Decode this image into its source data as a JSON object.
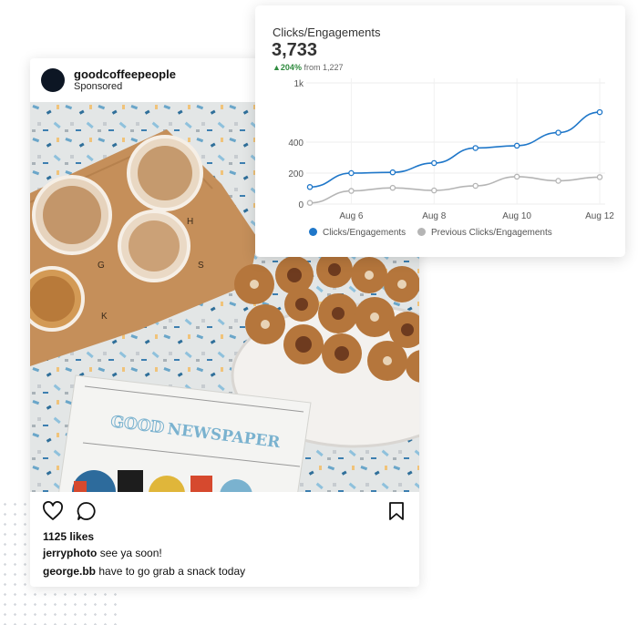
{
  "post": {
    "username": "goodcoffeepeople",
    "sponsored": "Sponsored",
    "likes": "1125 likes",
    "comments": [
      {
        "user": "jerryphoto",
        "text": "see ya soon!"
      },
      {
        "user": "george.bb",
        "text": "have to go grab a snack today"
      }
    ],
    "photo_text": {
      "newspaper_title_a": "GOOD",
      "newspaper_title_b": "NEWSPAPER",
      "board_letters": [
        "H",
        "S",
        "G",
        "K"
      ]
    },
    "icons": [
      "heart-icon",
      "comment-icon",
      "bookmark-icon"
    ]
  },
  "stats": {
    "title": "Clicks/Engagements",
    "value": "3,733",
    "change_pct": "204%",
    "change_from": "from 1,227"
  },
  "chart_data": {
    "type": "line",
    "x": [
      "Aug 5",
      "Aug 6",
      "Aug 7",
      "Aug 8",
      "Aug 9",
      "Aug 10",
      "Aug 11",
      "Aug 12"
    ],
    "xticks": [
      "Aug 6",
      "Aug 8",
      "Aug 10",
      "Aug 12"
    ],
    "yticks": [
      "0",
      "200",
      "400",
      "1k"
    ],
    "series": [
      {
        "name": "Clicks/Engagements",
        "color": "#1f77c9",
        "values": [
          110,
          200,
          205,
          265,
          362,
          377,
          496,
          704
        ]
      },
      {
        "name": "Previous Clicks/Engagements",
        "color": "#b5b5b5",
        "values": [
          8,
          85,
          105,
          88,
          118,
          177,
          150,
          174
        ]
      }
    ],
    "grid": true,
    "legend": "bottom"
  },
  "colors": {
    "accent": "#1f77c9",
    "previous": "#b5b5b5",
    "positive": "#2e8b3e"
  }
}
